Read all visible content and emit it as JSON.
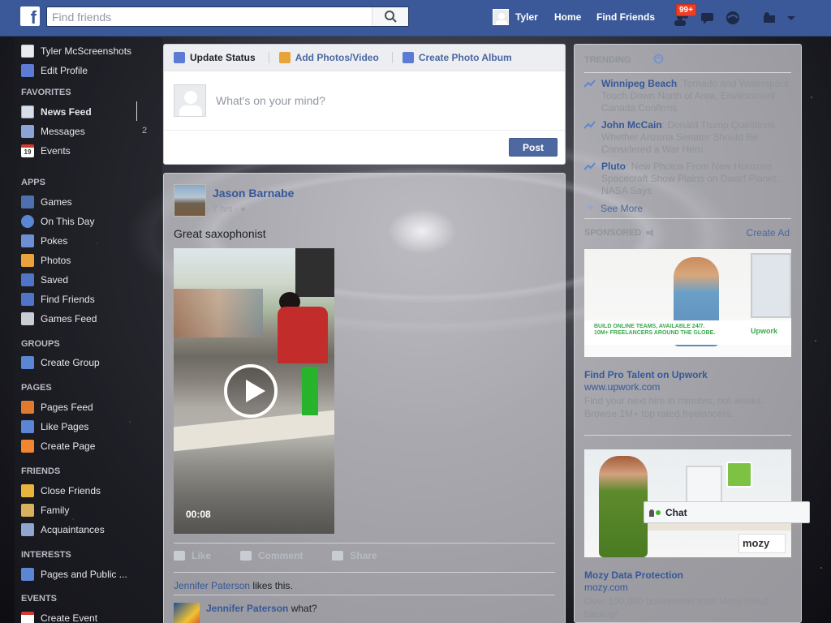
{
  "topbar": {
    "logo": "f",
    "search_placeholder": "Find friends",
    "user_name": "Tyler",
    "home": "Home",
    "find_friends": "Find Friends",
    "friend_requests_badge": "99+",
    "icons": [
      "friend-requests-icon",
      "messages-icon",
      "notifications-icon",
      "privacy-icon",
      "account-menu-icon"
    ]
  },
  "leftnav": {
    "profile_name": "Tyler McScreenshots",
    "edit_profile": "Edit Profile",
    "favorites_head": "FAVORITES",
    "favorites": [
      {
        "label": "News Feed",
        "icon": "news-feed-icon"
      },
      {
        "label": "Messages",
        "icon": "messages-icon",
        "count": "2"
      },
      {
        "label": "Events",
        "icon": "calendar-icon",
        "icon_text": "19"
      }
    ],
    "apps_head": "APPS",
    "apps": [
      {
        "label": "Games"
      },
      {
        "label": "On This Day"
      },
      {
        "label": "Pokes"
      },
      {
        "label": "Photos"
      },
      {
        "label": "Saved"
      },
      {
        "label": "Find Friends"
      },
      {
        "label": "Games Feed"
      }
    ],
    "groups_head": "GROUPS",
    "groups": [
      {
        "label": "Create Group"
      }
    ],
    "pages_head": "PAGES",
    "pages": [
      {
        "label": "Pages Feed"
      },
      {
        "label": "Like Pages"
      },
      {
        "label": "Create Page"
      }
    ],
    "friends_head": "FRIENDS",
    "friends": [
      {
        "label": "Close Friends"
      },
      {
        "label": "Family"
      },
      {
        "label": "Acquaintances"
      }
    ],
    "interests_head": "INTERESTS",
    "interests": [
      {
        "label": "Pages and Public ..."
      }
    ],
    "events_head": "EVENTS",
    "events": [
      {
        "label": "Create Event"
      }
    ]
  },
  "composer": {
    "tab_update": "Update Status",
    "tab_photos": "Add Photos/Video",
    "tab_album": "Create Photo Album",
    "placeholder": "What's on your mind?",
    "post": "Post"
  },
  "story": {
    "author": "Jason Barnabe",
    "time": "7 hrs · ",
    "text": "Great saxophonist",
    "duration": "00:08",
    "like": "Like",
    "comment": "Comment",
    "share": "Share",
    "liker": "Jennifer Paterson",
    "likes_suffix": " likes this.",
    "commenter": "Jennifer Paterson",
    "comment_text": " what?"
  },
  "rightcol": {
    "trending_head": "TRENDING",
    "trends": [
      {
        "name": "Winnipeg Beach",
        "desc": ": Tornado and Waterspout Touch Down North of Area, Environment Canada Confirms"
      },
      {
        "name": "John McCain",
        "desc": ": Donald Trump Questions Whether Arizona Senator Should Be Considered a War Hero"
      },
      {
        "name": "Pluto",
        "desc": ": New Photos From New Horizons Spacecraft Show Plains on Dwarf Planet, NASA Says"
      }
    ],
    "see_more": "See More",
    "sponsored_head": "SPONSORED",
    "create_ad": "Create Ad",
    "ads": [
      {
        "img_line1": "BUILD ONLINE TEAMS, AVAILABLE 24/7.",
        "img_line2": "10M+ FREELANCERS AROUND THE GLOBE.",
        "img_brand": "Upwork",
        "title": "Find Pro Talent on Upwork",
        "url": "www.upwork.com",
        "desc": "Find your next hire in minutes, not weeks. Browse 1M+ top rated freelancers."
      },
      {
        "img_brand": "mozy",
        "title": "Mozy Data Protection",
        "url": "mozy.com",
        "desc": "Over 100,000 businesses trust Mozy cloud backup!"
      }
    ]
  },
  "chat": {
    "label": "Chat"
  }
}
